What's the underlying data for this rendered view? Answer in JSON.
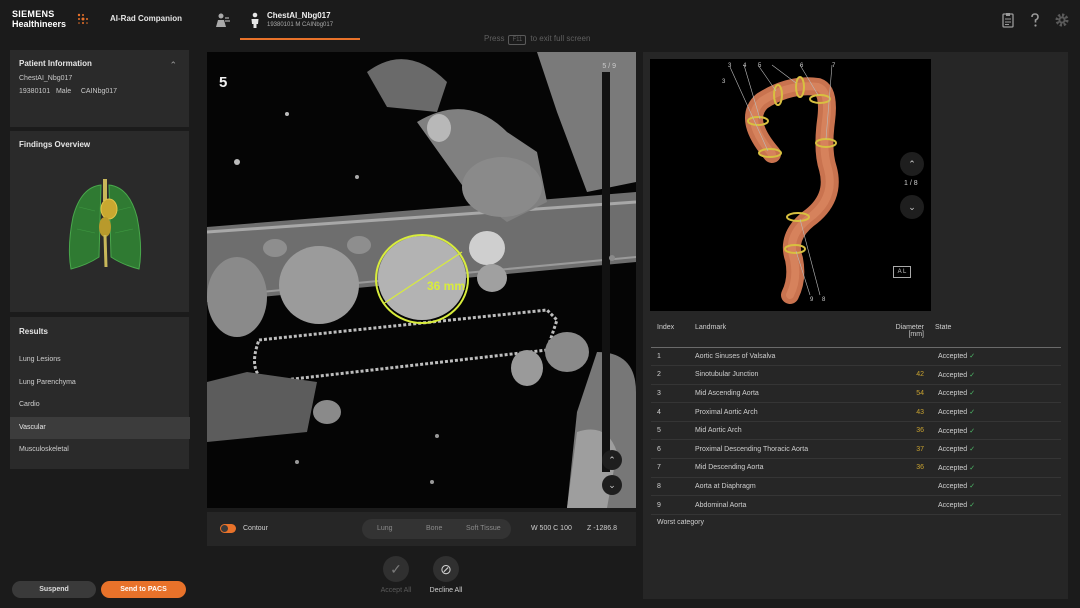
{
  "header": {
    "brand_line1": "SIEMENS",
    "brand_line2": "Healthineers",
    "app_title": "AI-Rad Companion",
    "patient_tab_name": "ChestAI_Nbg017",
    "patient_tab_sub": "19380101 M CAINbg017",
    "hint_prefix": "Press",
    "hint_key": "F11",
    "hint_suffix": "to exit full screen"
  },
  "patient_info": {
    "title": "Patient Information",
    "name": "ChestAI_Nbg017",
    "details": "19380101   Male     CAINbg017"
  },
  "findings": {
    "title": "Findings Overview"
  },
  "results": {
    "title": "Results",
    "items": [
      "Lung Lesions",
      "Lung Parenchyma",
      "Cardio",
      "Vascular",
      "Musculoskeletal"
    ],
    "active": "Vascular"
  },
  "buttons": {
    "suspend": "Suspend",
    "send_pacs": "Send to PACS"
  },
  "ct_view": {
    "number": "5",
    "slice": "5 / 9",
    "measurement": "36 mm",
    "contour_label": "Contour",
    "presets": [
      "Lung",
      "Bone",
      "Soft Tissue"
    ],
    "window_center": "W 500  C 100",
    "z_position": "Z -1286.8"
  },
  "actions": {
    "accept_all": "Accept All",
    "decline_all": "Decline All"
  },
  "view3d": {
    "page": "1 / 8",
    "badge": "A L",
    "labels_top": [
      "3",
      "3",
      "4",
      "5",
      "6",
      "7"
    ],
    "labels_bottom": [
      "9",
      "8"
    ]
  },
  "landmark_table": {
    "headers": {
      "index": "Index",
      "landmark": "Landmark",
      "diameter": "Diameter",
      "unit": "[mm]",
      "state": "State"
    },
    "rows": [
      {
        "index": "1",
        "landmark": "Aortic Sinuses of Valsalva",
        "diameter": "",
        "state": "Accepted"
      },
      {
        "index": "2",
        "landmark": "Sinotubular Junction",
        "diameter": "42",
        "state": "Accepted"
      },
      {
        "index": "3",
        "landmark": "Mid Ascending Aorta",
        "diameter": "54",
        "state": "Accepted"
      },
      {
        "index": "4",
        "landmark": "Proximal Aortic Arch",
        "diameter": "43",
        "state": "Accepted"
      },
      {
        "index": "5",
        "landmark": "Mid Aortic Arch",
        "diameter": "36",
        "state": "Accepted"
      },
      {
        "index": "6",
        "landmark": "Proximal Descending Thoracic Aorta",
        "diameter": "37",
        "state": "Accepted"
      },
      {
        "index": "7",
        "landmark": "Mid Descending Aorta",
        "diameter": "36",
        "state": "Accepted"
      },
      {
        "index": "8",
        "landmark": "Aorta at Diaphragm",
        "diameter": "",
        "state": "Accepted"
      },
      {
        "index": "9",
        "landmark": "Abdominal Aorta",
        "diameter": "",
        "state": "Accepted"
      }
    ],
    "worst_category": "Worst category"
  },
  "colors": {
    "accent": "#e8722a",
    "measure": "#d8ec3c",
    "accepted_check": "#4fbf6a",
    "diameter_text": "#c8a230"
  },
  "icons": [
    "worklist-icon",
    "person-icon",
    "report-icon",
    "help-icon",
    "settings-icon",
    "chevron-up-icon",
    "chevron-down-icon",
    "check-icon",
    "decline-icon"
  ]
}
